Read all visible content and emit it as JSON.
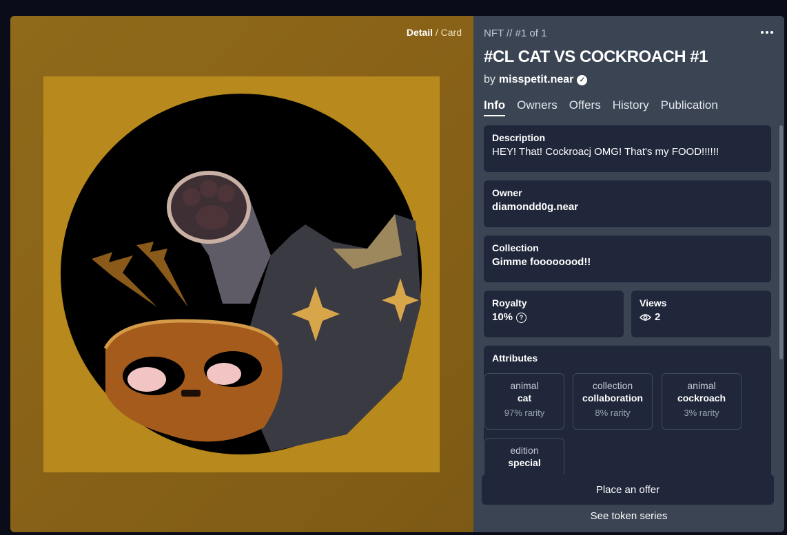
{
  "view_toggle": {
    "active": "Detail",
    "separator": "/",
    "inactive": "Card"
  },
  "breadcrumb": "NFT // #1 of 1",
  "title": "#CL CAT VS COCKROACH #1",
  "creator": {
    "by": "by",
    "name": "misspetit.near",
    "verified_icon": "verified-check-icon"
  },
  "tabs": [
    "Info",
    "Owners",
    "Offers",
    "History",
    "Publication"
  ],
  "active_tab": "Info",
  "description": {
    "label": "Description",
    "value": "HEY! That! Cockroacj OMG! That's my FOOD!!!!!!"
  },
  "owner": {
    "label": "Owner",
    "value": "diamondd0g.near"
  },
  "collection": {
    "label": "Collection",
    "value": "Gimme foooooood!!"
  },
  "royalty": {
    "label": "Royalty",
    "value": "10%"
  },
  "views": {
    "label": "Views",
    "value": "2"
  },
  "attributes": {
    "label": "Attributes",
    "items": [
      {
        "key": "animal",
        "value": "cat",
        "rarity": "97% rarity"
      },
      {
        "key": "collection",
        "value": "collaboration",
        "rarity": "8% rarity"
      },
      {
        "key": "animal",
        "value": "cockroach",
        "rarity": "3% rarity"
      },
      {
        "key": "edition",
        "value": "special",
        "rarity": ""
      }
    ]
  },
  "actions": {
    "place_offer": "Place an offer",
    "see_series": "See token series"
  },
  "colors": {
    "panel": "#3b4453",
    "card": "#20273a",
    "art_bg": "#b8891d"
  }
}
